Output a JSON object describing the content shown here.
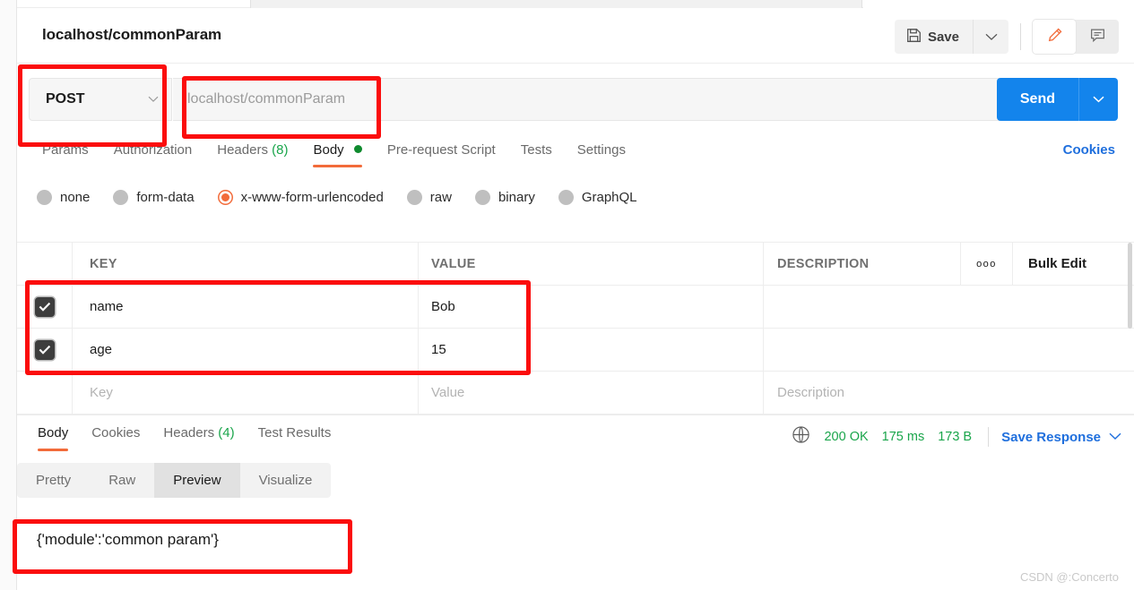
{
  "app": {
    "request_title": "localhost/commonParam",
    "watermark": "CSDN @:Concerto"
  },
  "titlebar": {
    "save_label": "Save",
    "save_icon": "floppy-disk-icon",
    "save_caret_icon": "chevron-down-icon",
    "edit_icon": "pencil-icon",
    "comment_icon": "comment-icon"
  },
  "urlbar": {
    "method": "POST",
    "method_caret_icon": "chevron-down-icon",
    "url_value": "localhost/commonParam",
    "send_label": "Send",
    "send_caret_icon": "chevron-down-icon"
  },
  "request_tabs": {
    "items": [
      {
        "label": "Params",
        "count": "",
        "active": false,
        "dot": false
      },
      {
        "label": "Authorization",
        "count": "",
        "active": false,
        "dot": false
      },
      {
        "label": "Headers",
        "count": "(8)",
        "active": false,
        "dot": false
      },
      {
        "label": "Body",
        "count": "",
        "active": true,
        "dot": true
      },
      {
        "label": "Pre-request Script",
        "count": "",
        "active": false,
        "dot": false
      },
      {
        "label": "Tests",
        "count": "",
        "active": false,
        "dot": false
      },
      {
        "label": "Settings",
        "count": "",
        "active": false,
        "dot": false
      }
    ],
    "cookies_link": "Cookies"
  },
  "body_types": {
    "options": [
      {
        "label": "none",
        "selected": false
      },
      {
        "label": "form-data",
        "selected": false
      },
      {
        "label": "x-www-form-urlencoded",
        "selected": true
      },
      {
        "label": "raw",
        "selected": false
      },
      {
        "label": "binary",
        "selected": false
      },
      {
        "label": "GraphQL",
        "selected": false
      }
    ]
  },
  "kv_table": {
    "headers": {
      "key": "KEY",
      "value": "VALUE",
      "description": "DESCRIPTION",
      "more_icon": "ooo",
      "bulk_edit": "Bulk Edit"
    },
    "rows": [
      {
        "checked": true,
        "key": "name",
        "value": "Bob",
        "description": ""
      },
      {
        "checked": true,
        "key": "age",
        "value": "15",
        "description": ""
      }
    ],
    "placeholder_row": {
      "key": "Key",
      "value": "Value",
      "description": "Description"
    }
  },
  "response": {
    "tabs": [
      {
        "label": "Body",
        "count": "",
        "active": true
      },
      {
        "label": "Cookies",
        "count": "",
        "active": false
      },
      {
        "label": "Headers",
        "count": "(4)",
        "active": false
      },
      {
        "label": "Test Results",
        "count": "",
        "active": false
      }
    ],
    "globe_icon": "globe-icon",
    "status": "200 OK",
    "time": "175 ms",
    "size": "173 B",
    "save_response": "Save Response",
    "save_response_caret_icon": "chevron-down-icon",
    "view_modes": [
      {
        "label": "Pretty",
        "active": false
      },
      {
        "label": "Raw",
        "active": false
      },
      {
        "label": "Preview",
        "active": true
      },
      {
        "label": "Visualize",
        "active": false
      }
    ],
    "body_text": "{'module':'common param'}"
  },
  "colors": {
    "accent_orange": "#f26b3a",
    "send_blue": "#1384ec",
    "link_blue": "#1f6fdd",
    "status_green": "#1aa54b",
    "annotation_red": "#fb0d0d"
  }
}
